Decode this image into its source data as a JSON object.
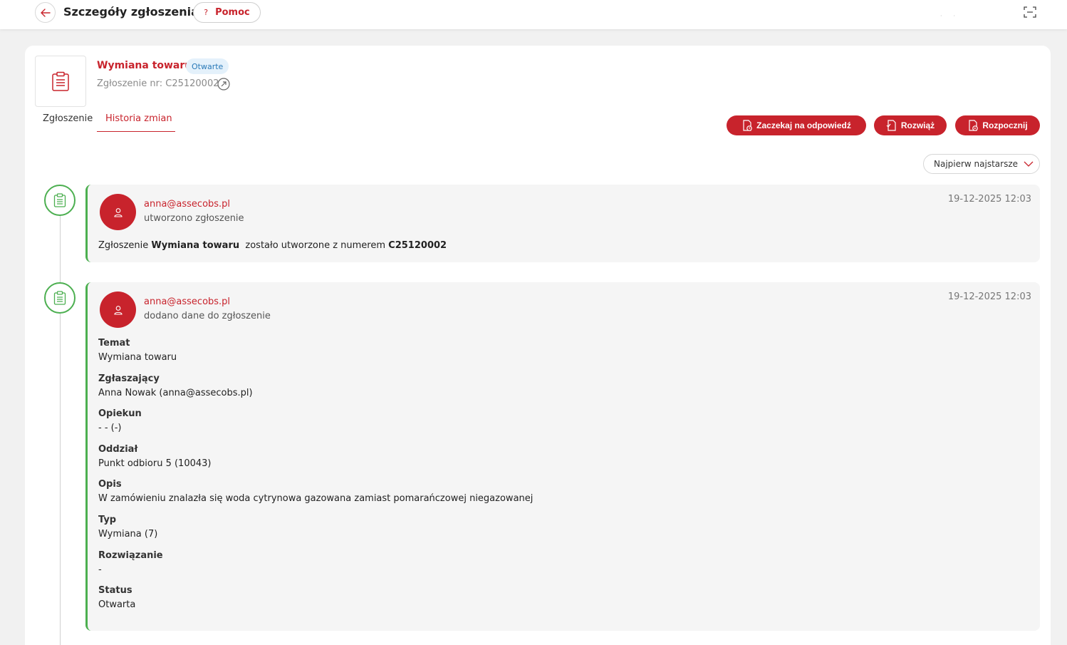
{
  "header": {
    "title": "Szczegóły zgłoszenia",
    "help_label": "Pomoc",
    "help_icon": "?"
  },
  "ticket": {
    "title": "Wymiana towaru",
    "status": "Otwarte",
    "number_label": "Zgłoszenie nr: C25120002"
  },
  "tabs": {
    "ticket": "Zgłoszenie",
    "history": "Historia zmian"
  },
  "actions": {
    "wait": "Zaczekaj na odpowiedź",
    "solve": "Rozwiąż",
    "start": "Rozpocznij"
  },
  "sort": {
    "selected": "Najpierw najstarsze"
  },
  "history": [
    {
      "author": "anna@assecobs.pl",
      "action": "utworzono zgłoszenie",
      "date": "19-12-2025 12:03",
      "body_prefix": "Zgłoszenie ",
      "body_subject": "Wymiana towaru",
      "body_middle": "  zostało utworzone z numerem ",
      "body_number": "C25120002"
    },
    {
      "author": "anna@assecobs.pl",
      "action": "dodano dane do zgłoszenie",
      "date": "19-12-2025 12:03",
      "fields": [
        {
          "label": "Temat",
          "value": "Wymiana towaru"
        },
        {
          "label": "Zgłaszający",
          "value": "Anna Nowak (anna@assecobs.pl)"
        },
        {
          "label": "Opiekun",
          "value": "- - (-)"
        },
        {
          "label": "Oddział",
          "value": "Punkt odbioru 5 (10043)"
        },
        {
          "label": "Opis",
          "value": "W zamówieniu znalazła się woda cytrynowa gazowana zamiast pomarańczowej niegazowanej"
        },
        {
          "label": "Typ",
          "value": "Wymiana (7)"
        },
        {
          "label": "Rozwiązanie",
          "value": "-"
        },
        {
          "label": "Status",
          "value": "Otwarta"
        }
      ]
    }
  ],
  "colors": {
    "accent": "#c8232c",
    "timeline": "#4caf50",
    "status_bg": "#e4f1fb",
    "status_text": "#2a7ab8"
  },
  "icons": {
    "back": "arrow-left-icon",
    "fullscreen": "fullscreen-icon",
    "ticket": "clipboard-icon",
    "external": "external-link-icon",
    "avatar": "user-icon",
    "sort": "chevron-down-icon"
  }
}
